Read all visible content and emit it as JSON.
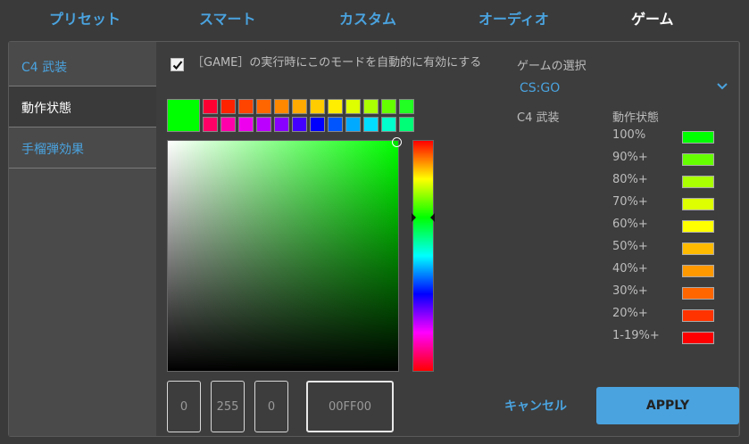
{
  "tabs": [
    {
      "label": "プリセット",
      "active": false
    },
    {
      "label": "スマート",
      "active": false
    },
    {
      "label": "カスタム",
      "active": false
    },
    {
      "label": "オーディオ",
      "active": false
    },
    {
      "label": "ゲーム",
      "active": true
    }
  ],
  "sidebar": {
    "items": [
      {
        "label": "C4 武装",
        "active": false
      },
      {
        "label": "動作状態",
        "active": true
      },
      {
        "label": "手榴弾効果",
        "active": false
      }
    ]
  },
  "checkbox": {
    "checked": true,
    "label": "［GAME］の実行時にこのモードを自動的に有効にする"
  },
  "color": {
    "preview": "#00ff00",
    "r": "0",
    "g": "255",
    "b": "0",
    "hex": "00FF00"
  },
  "swatches": {
    "row1": [
      "#ff0033",
      "#ff2200",
      "#ff4400",
      "#ff6600",
      "#ff8800",
      "#ffaa00",
      "#ffcc00",
      "#ffee00",
      "#ddff00",
      "#aaff00",
      "#66ff00",
      "#22ff22"
    ],
    "row2": [
      "#ff0066",
      "#ff00aa",
      "#ee00ee",
      "#bb00ff",
      "#8800ff",
      "#4400ff",
      "#0000ff",
      "#0055ff",
      "#00aaff",
      "#00ddff",
      "#00ffcc",
      "#00ff77"
    ]
  },
  "game_select": {
    "label": "ゲームの選択",
    "value": "CS:GO"
  },
  "levels": {
    "c4_label": "C4 武装",
    "status_label": "動作状態",
    "items": [
      {
        "label": "100%",
        "color": "#00ff00"
      },
      {
        "label": "90%+",
        "color": "#66ff00"
      },
      {
        "label": "80%+",
        "color": "#aaff00"
      },
      {
        "label": "70%+",
        "color": "#ddff00"
      },
      {
        "label": "60%+",
        "color": "#ffff00"
      },
      {
        "label": "50%+",
        "color": "#ffbb00"
      },
      {
        "label": "40%+",
        "color": "#ff9900"
      },
      {
        "label": "30%+",
        "color": "#ff6600"
      },
      {
        "label": "20%+",
        "color": "#ff3300"
      },
      {
        "label": "1-19%+",
        "color": "#ff0000"
      }
    ]
  },
  "buttons": {
    "cancel": "キャンセル",
    "apply": "APPLY"
  },
  "theme": {
    "accent": "#4aa3df"
  }
}
